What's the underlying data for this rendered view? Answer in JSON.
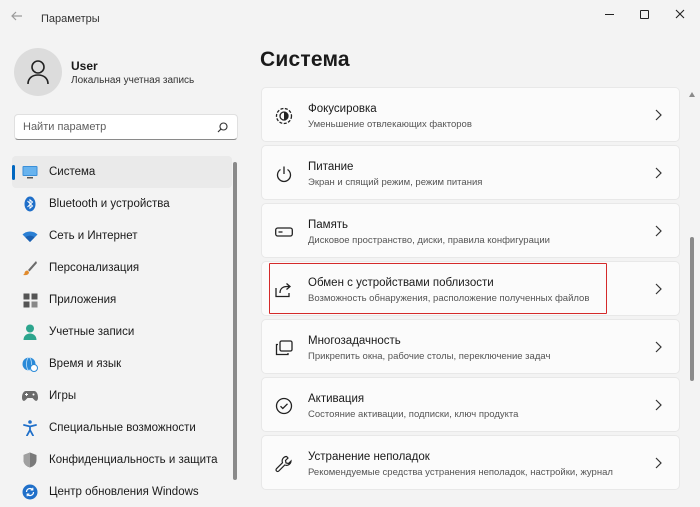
{
  "window": {
    "title": "Параметры"
  },
  "user": {
    "name": "User",
    "account_type": "Локальная учетная запись"
  },
  "search": {
    "placeholder": "Найти параметр"
  },
  "sidebar": {
    "items": [
      {
        "label": "Система",
        "icon": "monitor-icon",
        "active": true
      },
      {
        "label": "Bluetooth и устройства",
        "icon": "bluetooth-icon",
        "active": false
      },
      {
        "label": "Сеть и Интернет",
        "icon": "wifi-icon",
        "active": false
      },
      {
        "label": "Персонализация",
        "icon": "brush-icon",
        "active": false
      },
      {
        "label": "Приложения",
        "icon": "apps-icon",
        "active": false
      },
      {
        "label": "Учетные записи",
        "icon": "account-icon",
        "active": false
      },
      {
        "label": "Время и язык",
        "icon": "globe-clock-icon",
        "active": false
      },
      {
        "label": "Игры",
        "icon": "gamepad-icon",
        "active": false
      },
      {
        "label": "Специальные возможности",
        "icon": "accessibility-icon",
        "active": false
      },
      {
        "label": "Конфиденциальность и защита",
        "icon": "shield-icon",
        "active": false
      },
      {
        "label": "Центр обновления Windows",
        "icon": "update-icon",
        "active": false
      }
    ]
  },
  "main": {
    "title": "Система",
    "items": [
      {
        "title": "Фокусировка",
        "subtitle": "Уменьшение отвлекающих факторов",
        "icon": "focus-icon"
      },
      {
        "title": "Питание",
        "subtitle": "Экран и спящий режим, режим питания",
        "icon": "power-icon"
      },
      {
        "title": "Память",
        "subtitle": "Дисковое пространство, диски, правила конфигурации",
        "icon": "storage-icon"
      },
      {
        "title": "Обмен с устройствами поблизости",
        "subtitle": "Возможность обнаружения, расположение полученных файлов",
        "icon": "share-icon"
      },
      {
        "title": "Многозадачность",
        "subtitle": "Прикрепить окна, рабочие столы, переключение задач",
        "icon": "multitasking-icon"
      },
      {
        "title": "Активация",
        "subtitle": "Состояние активации, подписки, ключ продукта",
        "icon": "activation-icon"
      },
      {
        "title": "Устранение неполадок",
        "subtitle": "Рекомендуемые средства устранения неполадок, настройки, журнал",
        "icon": "wrench-icon"
      }
    ]
  },
  "colors": {
    "accent": "#0067c0",
    "highlight_border": "#d42a2a",
    "background": "#f3f3f3",
    "card": "#fbfbfb"
  }
}
